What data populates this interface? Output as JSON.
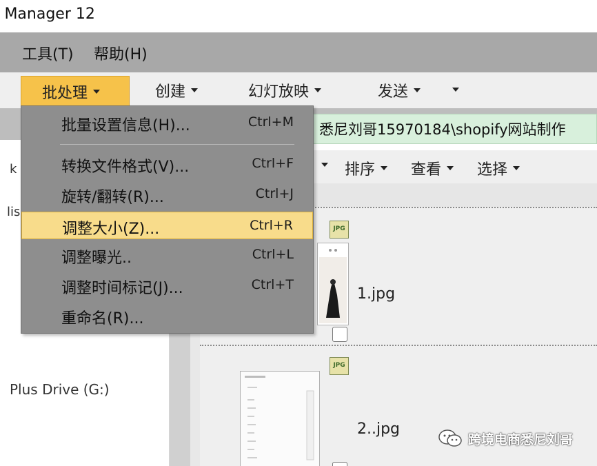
{
  "window": {
    "title": "o Manager 12"
  },
  "menubar": {
    "items": [
      "工具(T)",
      "帮助(H)"
    ]
  },
  "toolbar": {
    "batch": "批处理",
    "create": "创建",
    "slideshow": "幻灯放映",
    "send": "发送"
  },
  "address": {
    "value": "悉尼刘哥15970184\\shopify网站制作"
  },
  "left_panel": {
    "frag_k": "k",
    "frag_lis": "lis",
    "drive": "Plus Drive (G:)"
  },
  "sortbar": {
    "sort": "排序",
    "view": "查看",
    "select": "选择"
  },
  "batch_menu": {
    "items": [
      {
        "label": "批量设置信息(H)...",
        "shortcut": "Ctrl+M"
      },
      {
        "label": "转换文件格式(V)...",
        "shortcut": "Ctrl+F"
      },
      {
        "label": "旋转/翻转(R)...",
        "shortcut": "Ctrl+J"
      },
      {
        "label": "调整大小(Z)...",
        "shortcut": "Ctrl+R"
      },
      {
        "label": "调整曝光..",
        "shortcut": "Ctrl+L"
      },
      {
        "label": "调整时间标记(J)...",
        "shortcut": "Ctrl+T"
      },
      {
        "label": "重命名(R)...",
        "shortcut": ""
      }
    ],
    "highlighted_index": 3
  },
  "files": [
    {
      "name": "1.jpg",
      "badge": "JPG"
    },
    {
      "name": "2..jpg",
      "badge": "JPG"
    }
  ],
  "watermark": {
    "text": "跨境电商悉尼刘哥"
  },
  "colors": {
    "accent": "#f6c24a",
    "highlight": "#f8dc8b",
    "address_bg": "#d8f0dc"
  }
}
